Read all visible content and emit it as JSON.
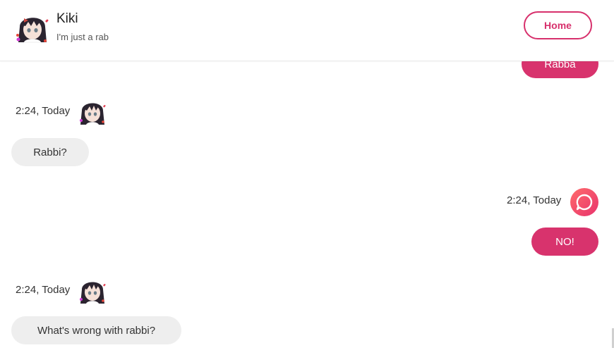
{
  "header": {
    "name": "Kiki",
    "status": "I'm just a rab",
    "home_label": "Home"
  },
  "messages": [
    {
      "direction": "out",
      "text": "Rabba"
    },
    {
      "direction": "in",
      "time": "2:24, Today",
      "text": "Rabbi?"
    },
    {
      "direction": "out",
      "time": "2:24, Today",
      "text": "NO!"
    },
    {
      "direction": "in",
      "time": "2:24, Today",
      "text": "What's wrong with rabbi?"
    }
  ],
  "icons": {
    "bot_avatar": "anime-girl-avatar",
    "user_avatar": "chat-bubble-icon"
  },
  "colors": {
    "accent": "#d8336d",
    "incoming_bubble": "#eeeeee"
  }
}
